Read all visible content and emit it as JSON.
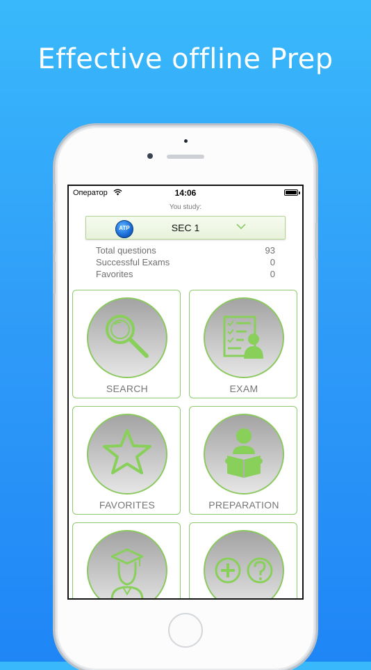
{
  "headline": "Effective offline Prep",
  "status_bar": {
    "carrier": "Оператор",
    "time": "14:06"
  },
  "study": {
    "label": "You study:",
    "logo_text": "ATP",
    "selected": "SEC 1"
  },
  "stats": [
    {
      "label": "Total questions",
      "value": "93"
    },
    {
      "label": "Successful Exams",
      "value": "0"
    },
    {
      "label": "Favorites",
      "value": "0"
    }
  ],
  "tiles": {
    "search": "SEARCH",
    "exam": "EXAM",
    "favorites": "FAVORITES",
    "preparation": "PREPARATION"
  },
  "colors": {
    "background_top": "#39b9fb",
    "background_bottom": "#1f86f6",
    "icon_green": "#88d05a",
    "tile_border": "#8cc96a"
  },
  "icons": [
    "wifi-icon",
    "battery-icon",
    "chevron-down-icon",
    "magnifier-icon",
    "exam-checklist-icon",
    "star-icon",
    "reading-person-icon",
    "graduate-icon",
    "plus-question-icon"
  ]
}
